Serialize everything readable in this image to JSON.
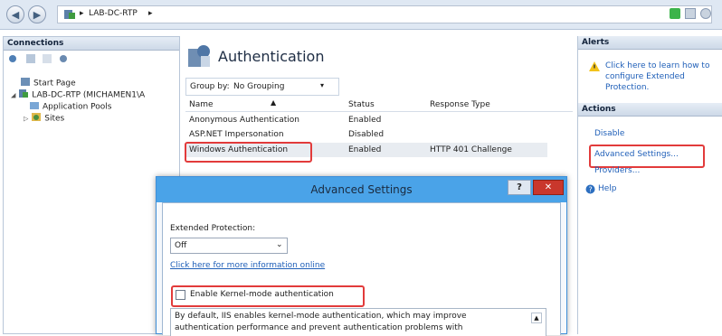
{
  "address_bar": {
    "breadcrumb": [
      "LAB-DC-RTP",
      "▸"
    ]
  },
  "connections": {
    "title": "Connections",
    "tree": [
      {
        "label": "Start Page"
      },
      {
        "label": "LAB-DC-RTP (MICHAMEN1\\A"
      },
      {
        "label": "Application Pools"
      },
      {
        "label": "Sites"
      }
    ]
  },
  "center": {
    "title": "Authentication",
    "group_by_label": "Group by:",
    "group_by_value": "No Grouping",
    "columns": [
      "Name",
      "Status",
      "Response Type"
    ],
    "rows": [
      {
        "name": "Anonymous Authentication",
        "status": "Enabled",
        "response": ""
      },
      {
        "name": "ASP.NET Impersonation",
        "status": "Disabled",
        "response": ""
      },
      {
        "name": "Windows Authentication",
        "status": "Enabled",
        "response": "HTTP 401 Challenge"
      }
    ]
  },
  "alerts": {
    "title": "Alerts",
    "message": [
      "Click here to learn how to",
      "configure Extended",
      "Protection."
    ]
  },
  "actions": {
    "title": "Actions",
    "items": [
      "Disable",
      "Advanced Settings...",
      "Providers..."
    ],
    "help": "Help"
  },
  "dialog": {
    "title": "Advanced Settings",
    "help_btn": "?",
    "close_btn": "✕",
    "ext_protection_label": "Extended Protection:",
    "ext_protection_value": "Off",
    "more_info_link": "Click here for more information online",
    "kernel_checkbox_label": "Enable Kernel-mode authentication",
    "kernel_checked": false,
    "description": [
      "By default, IIS enables kernel-mode authentication, which may improve",
      "authentication performance and prevent authentication problems with"
    ]
  },
  "colors": {
    "highlight_red": "#e23b3b",
    "dialog_title_blue": "#4aa3e8",
    "link_blue": "#1f5fb8"
  }
}
